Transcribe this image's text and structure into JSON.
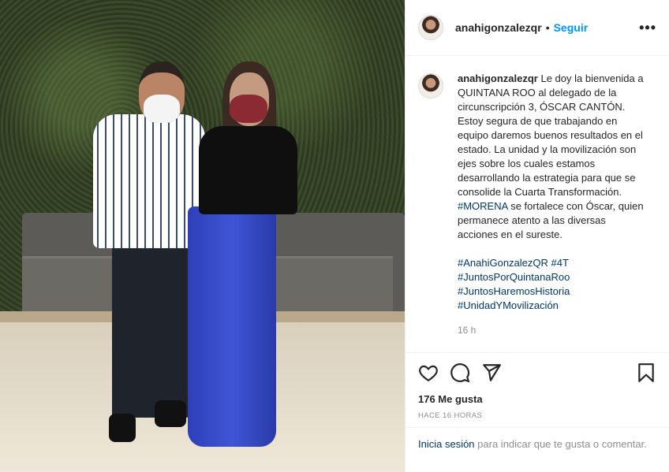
{
  "post": {
    "username": "anahigonzalezqr",
    "follow_label": "Seguir",
    "separator": "•",
    "more_label": "•••"
  },
  "caption": {
    "username": "anahigonzalezqr",
    "text": "Le doy la bienvenida a QUINTANA ROO al delegado de la circunscripción 3, ÓSCAR CANTÓN. Estoy segura de que trabajando en equipo daremos buenos resultados en el estado. La unidad y la movilización son ejes sobre los cuales estamos desarrollando la estrategia para que se consolide la Cuarta Transformación.",
    "inline_tag": "#MORENA",
    "text_after_tag": "se fortalece con Óscar, quien permanece atento a las diversas acciones en el sureste.",
    "hashtags": [
      "#AnahiGonzalezQR #4T",
      "#JuntosPorQuintanaRoo",
      "#JuntosHaremosHistoria",
      "#UnidadYMovilización"
    ],
    "time": "16 h"
  },
  "icons": {
    "like": "heart-icon",
    "comment": "comment-icon",
    "share": "share-icon",
    "save": "bookmark-icon",
    "more": "more-options-icon"
  },
  "stats": {
    "likes": "176 Me gusta",
    "ago": "HACE 16 HORAS"
  },
  "login": {
    "link": "Inicia sesión",
    "rest": "para indicar que te gusta o comentar."
  },
  "colors": {
    "accent": "#0095f6",
    "hashtag": "#00376b",
    "muted": "#8e8e8e",
    "text": "#262626"
  }
}
